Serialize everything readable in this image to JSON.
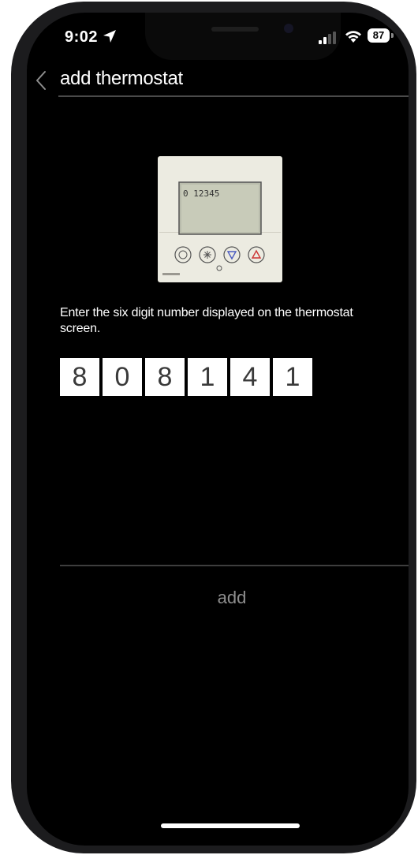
{
  "status_bar": {
    "time": "9:02",
    "battery": "87",
    "icons": [
      "location-arrow-icon",
      "cellular-signal-icon",
      "wifi-icon",
      "battery-icon"
    ]
  },
  "header": {
    "title": "add thermostat",
    "back_icon": "chevron-left-icon"
  },
  "thermostat_image": {
    "display_digits": "0 12345"
  },
  "instruction": "Enter the six digit number displayed on the thermostat screen.",
  "code_digits": [
    "8",
    "0",
    "8",
    "1",
    "4",
    "1"
  ],
  "footer": {
    "add_label": "add"
  },
  "colors": {
    "background": "#000000",
    "text": "#ffffff",
    "muted": "#8e8e8e",
    "device_body": "#ecebe1"
  }
}
